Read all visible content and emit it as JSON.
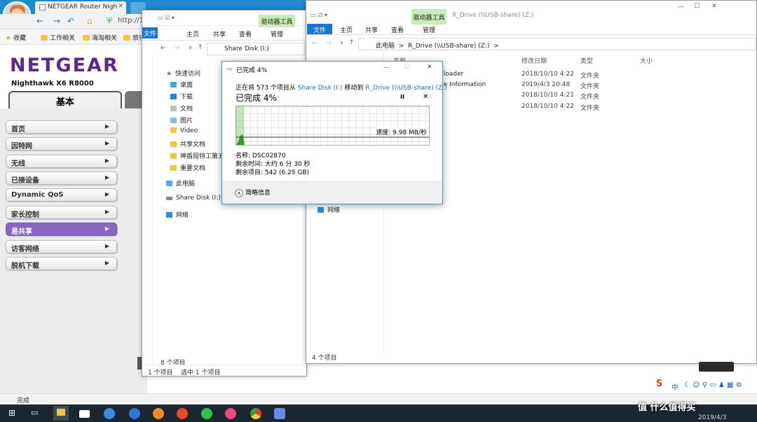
{
  "browser": {
    "tab_title": "NETGEAR Router Nigh",
    "address_partial": "http://10",
    "status": "完成",
    "bookmarks": [
      "收藏",
      "工作相关",
      "海淘相关",
      "旅行"
    ]
  },
  "netgear": {
    "logo": "NETGEAR",
    "model": "Nighthawk X6 R8000",
    "tab_basic": "基本",
    "menu": [
      "首页",
      "因特网",
      "无线",
      "已接设备",
      "Dynamic QoS",
      "家长控制",
      "易共享",
      "访客网络",
      "脱机下载"
    ],
    "active_menu": "易共享"
  },
  "explorer_left": {
    "file_tab": "文件",
    "tool_tab": "驱动器工具",
    "ribbon_tabs": [
      "主页",
      "共享",
      "查看",
      "管理"
    ],
    "path": "Share Disk (I:)",
    "nav_items": [
      "快速访问",
      "桌面",
      "下载",
      "文档",
      "图片",
      "Video",
      "共享文档",
      "神盾局特工第五",
      "重要文档",
      "此电脑",
      "Share Disk (I:)",
      "网络"
    ],
    "status_count": "8 个项目",
    "status_items": "1 个项目",
    "status_selected": "选中 1 个项目"
  },
  "explorer_right": {
    "file_tab": "文件",
    "tool_tab": "驱动器工具",
    "title": "R_Drive (\\\\USB-share) (Z:)",
    "ribbon_tabs": [
      "主页",
      "共享",
      "查看",
      "管理"
    ],
    "path_root": "此电脑",
    "path_leaf": "R_Drive (\\\\USB-share) (Z:)",
    "columns": [
      "名称",
      "修改日期",
      "类型",
      "大小"
    ],
    "rows": [
      {
        "name": "nloader",
        "date": "2018/10/10 4:22",
        "type": "文件夹"
      },
      {
        "name": "ne Information",
        "date": "2019/4/3 20:48",
        "type": "文件夹"
      },
      {
        "name": "",
        "date": "2018/10/10 4:21",
        "type": "文件夹"
      },
      {
        "name": "",
        "date": "2018/10/10 4:22",
        "type": "文件夹"
      }
    ],
    "nav_network": "网络",
    "status_count": "4 个项目"
  },
  "copy_dialog": {
    "title": "已完成 4%",
    "line1_prefix": "正在将 573 个项目从",
    "source": "Share Disk (I:)",
    "line1_mid": "移动到",
    "destination": "R_Drive (\\\\USB-share) (Z:)",
    "progress_heading": "已完成 4%",
    "progress_fraction": 0.04,
    "speed": "速度: 9.98 MB/秒",
    "name_label": "名称:",
    "name_value": "DSC02870",
    "time_label": "剩余时间:",
    "time_value": "大约 6 分 30 秒",
    "items_label": "剩余项目:",
    "items_value": "542 (6.25 GB)",
    "less_info": "简略信息",
    "pause_symbol": "II",
    "close_symbol": "✕"
  },
  "taskbar": {
    "date": "2019/4/3",
    "tray_label": "中",
    "watermark": "值 什么值得买"
  }
}
